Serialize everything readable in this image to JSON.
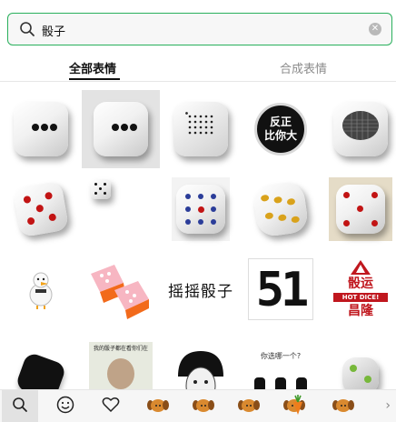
{
  "search": {
    "query": "骰子",
    "icon": "search-icon",
    "clear_icon": "clear-icon",
    "accent_color": "#29b05c"
  },
  "tabs": [
    {
      "label": "全部表情",
      "active": true
    },
    {
      "label": "合成表情",
      "active": false
    }
  ],
  "stickers": {
    "bubble_text_line1": "反正",
    "bubble_text_line2": "比你大",
    "dice_text": "摇摇骰子",
    "digit_text": "51",
    "badge_top": "骰运",
    "badge_mid": "HOT DICE!",
    "badge_bottom": "昌隆",
    "ask_text": "你选哪一个?",
    "meme_caption": "我的骰子都在看你们在"
  },
  "bottom_bar": {
    "items": [
      "search-icon",
      "emoji-icon",
      "heart-icon",
      "dog-sticker-1",
      "dog-sticker-2",
      "dog-sticker-3",
      "dog-sticker-4",
      "carrot-sticker",
      "dog-sticker-5"
    ],
    "more_icon": "chevron-right-icon",
    "selected_index": 0
  }
}
